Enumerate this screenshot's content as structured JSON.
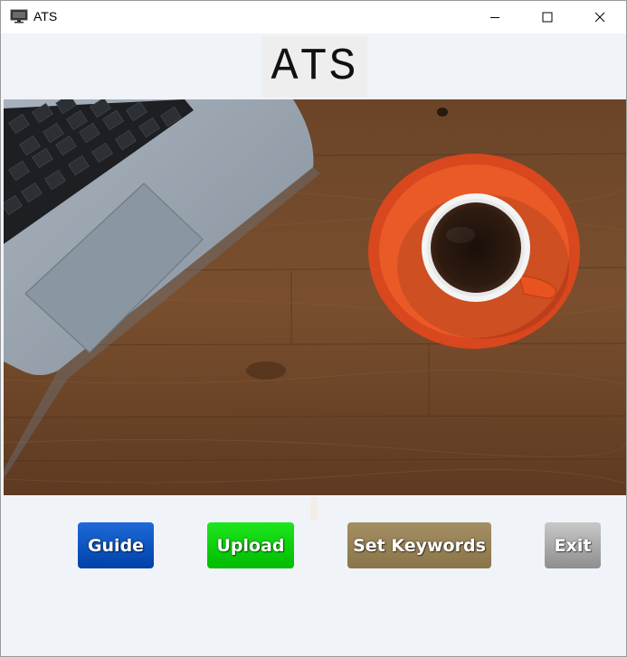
{
  "window": {
    "title": "ATS",
    "controls": {
      "minimize": "minimize-icon",
      "maximize": "maximize-icon",
      "close": "close-icon"
    }
  },
  "header": {
    "title": "ATS"
  },
  "hero": {
    "image": "laptop-and-coffee-on-wooden-desk"
  },
  "actions": {
    "guide_label": "Guide",
    "upload_label": "Upload",
    "keywords_label": "Set Keywords",
    "exit_label": "Exit"
  },
  "colors": {
    "guide": "#0b55c8",
    "upload": "#00d200",
    "keywords": "#967f54",
    "exit": "#a9a9a9",
    "background": "#f0f3f8"
  }
}
